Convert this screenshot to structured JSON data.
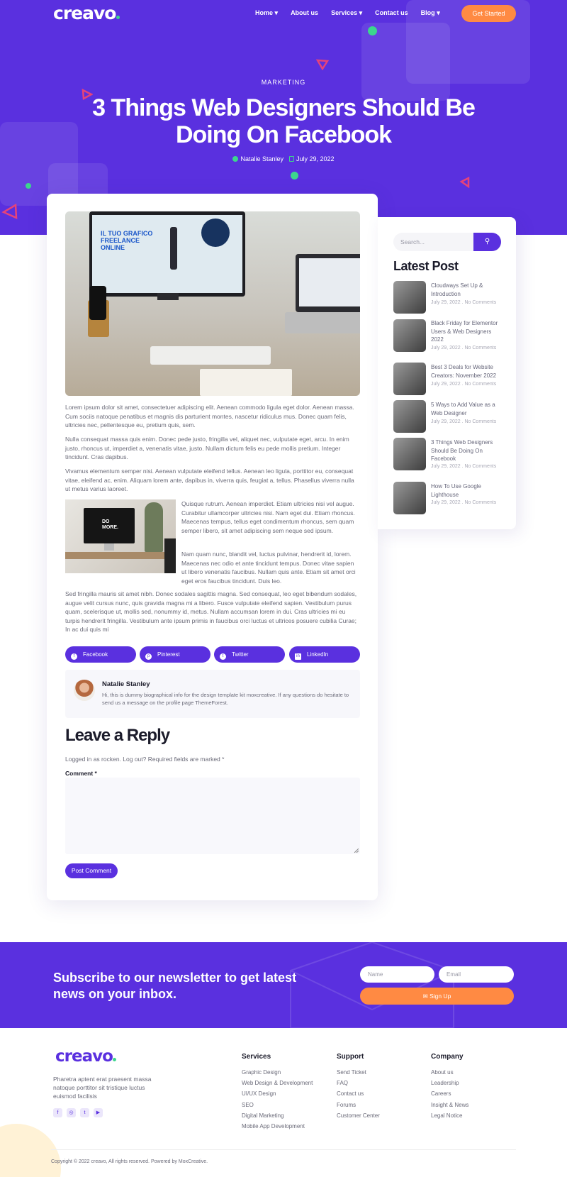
{
  "header": {
    "logo": "creavo",
    "nav": [
      {
        "label": "Home",
        "dropdown": true
      },
      {
        "label": "About us",
        "dropdown": false
      },
      {
        "label": "Services",
        "dropdown": true
      },
      {
        "label": "Contact us",
        "dropdown": false
      },
      {
        "label": "Blog",
        "dropdown": true
      }
    ],
    "cta": "Get Started"
  },
  "hero": {
    "category": "MARKETING",
    "title": "3 Things Web Designers Should Be Doing On Facebook",
    "author": "Natalie Stanley",
    "date": "July 29, 2022"
  },
  "article": {
    "image_text": "IL TUO GRAFICO FREELANCE ONLINE",
    "p1": "Lorem ipsum dolor sit amet, consectetuer adipiscing elit. Aenean commodo ligula eget dolor. Aenean massa. Cum sociis natoque penatibus et magnis dis parturient montes, nascetur ridiculus mus. Donec quam felis, ultricies nec, pellentesque eu, pretium quis, sem.",
    "p2": "Nulla consequat massa quis enim. Donec pede justo, fringilla vel, aliquet nec, vulputate eget, arcu. In enim justo, rhoncus ut, imperdiet a, venenatis vitae, justo. Nullam dictum felis eu pede mollis pretium. Integer tincidunt. Cras dapibus.",
    "p3": "Vivamus elementum semper nisi. Aenean vulputate eleifend tellus. Aenean leo ligula, porttitor eu, consequat vitae, eleifend ac, enim. Aliquam lorem ante, dapibus in, viverra quis, feugiat a, tellus. Phasellus viverra nulla ut metus varius laoreet.",
    "image2_text": "DO MORE.",
    "p4": "Quisque rutrum. Aenean imperdiet. Etiam ultricies nisi vel augue. Curabitur ullamcorper ultricies nisi. Nam eget dui. Etiam rhoncus. Maecenas tempus, tellus eget condimentum rhoncus, sem quam semper libero, sit amet adipiscing sem neque sed ipsum.",
    "p5": "Nam quam nunc, blandit vel, luctus pulvinar, hendrerit id, lorem. Maecenas nec odio et ante tincidunt tempus. Donec vitae sapien ut libero venenatis faucibus. Nullam quis ante. Etiam sit amet orci eget eros faucibus tincidunt. Duis leo.",
    "p6": "Sed fringilla mauris sit amet nibh. Donec sodales sagittis magna. Sed consequat, leo eget bibendum sodales, augue velit cursus nunc, quis gravida magna mi a libero. Fusce vulputate eleifend sapien. Vestibulum purus quam, scelerisque ut, mollis sed, nonummy id, metus. Nullam accumsan lorem in dui. Cras ultricies mi eu turpis hendrerit fringilla. Vestibulum ante ipsum primis in faucibus orci luctus et ultrices posuere cubilia Curae; In ac dui quis mi"
  },
  "share": [
    {
      "label": "Facebook",
      "icon": "facebook-icon",
      "glyph": "f"
    },
    {
      "label": "Pinterest",
      "icon": "pinterest-icon",
      "glyph": "p"
    },
    {
      "label": "Twitter",
      "icon": "twitter-icon",
      "glyph": "t"
    },
    {
      "label": "LinkedIn",
      "icon": "linkedin-icon",
      "glyph": "in"
    }
  ],
  "author_box": {
    "name": "Natalie Stanley",
    "bio": "Hi, this is dummy biographical info for the design template kit moxcreative. If any questions do hesitate to send us a message on the profile page ThemeForest."
  },
  "reply": {
    "heading": "Leave a Reply",
    "logged_in": "Logged in as rocken. Log out? Required fields are marked *",
    "comment_label": "Comment *",
    "button": "Post Comment"
  },
  "sidebar": {
    "search_placeholder": "Search...",
    "latest_heading": "Latest Post",
    "posts": [
      {
        "title": "Cloudways Set Up & Introduction",
        "meta": "July 29, 2022 . No Comments"
      },
      {
        "title": "Black Friday for Elementor Users & Web Designers 2022",
        "meta": "July 29, 2022 . No Comments"
      },
      {
        "title": "Best 3 Deals for Website Creators: November 2022",
        "meta": "July 29, 2022 . No Comments"
      },
      {
        "title": "5 Ways to Add Value as a Web Designer",
        "meta": "July 29, 2022 . No Comments"
      },
      {
        "title": "3 Things Web Designers Should Be Doing On Facebook",
        "meta": "July 29, 2022 . No Comments"
      },
      {
        "title": "How To Use Google Lighthouse",
        "meta": "July 29, 2022 . No Comments"
      }
    ]
  },
  "newsletter": {
    "heading": "Subscribe to our newsletter to get latest news on your inbox.",
    "name_placeholder": "Name",
    "email_placeholder": "Email",
    "button": "Sign Up"
  },
  "footer": {
    "logo": "creavo",
    "description": "Pharetra aptent erat praesent massa natoque porttitor sit tristique luctus euismod facilisis",
    "socials": [
      "facebook-icon",
      "instagram-icon",
      "twitter-icon",
      "youtube-icon"
    ],
    "columns": [
      {
        "heading": "Services",
        "items": [
          "Graphic Design",
          "Web Design & Development",
          "UI/UX Design",
          "SEO",
          "Digital Marketing",
          "Mobile App Development"
        ]
      },
      {
        "heading": "Support",
        "items": [
          "Send Ticket",
          "FAQ",
          "Contact us",
          "Forums",
          "Customer Center"
        ]
      },
      {
        "heading": "Company",
        "items": [
          "About us",
          "Leadership",
          "Careers",
          "Insight & News",
          "Legal Notice"
        ]
      }
    ],
    "copyright": "Copyright © 2022 creavo, All rights reserved. Powered by MoxCreative."
  },
  "colors": {
    "primary": "#5a30df",
    "accent": "#ff8a43",
    "green": "#3cd68d",
    "pink": "#e5437a"
  }
}
